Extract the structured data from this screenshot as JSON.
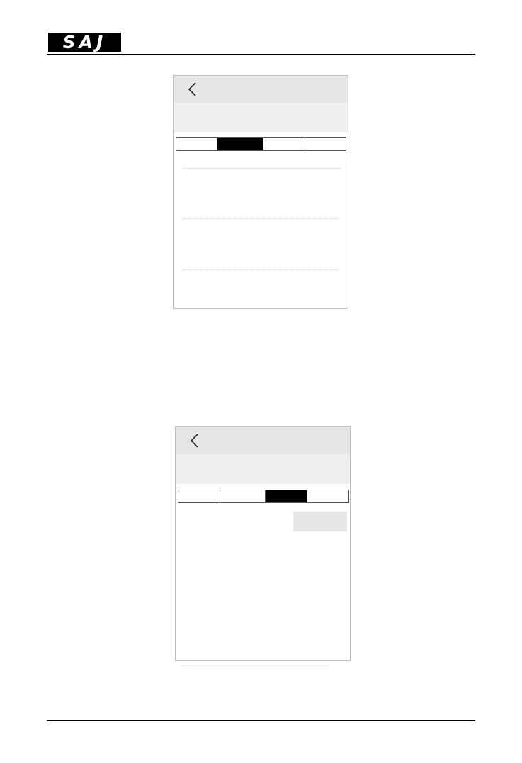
{
  "header": {
    "logo_text": "SAJ",
    "logo_color": "#000000"
  },
  "screens": [
    {
      "back_icon": "chevron-left-icon",
      "tab_count": 4,
      "active_tab_index": 1
    },
    {
      "back_icon": "chevron-left-icon",
      "tab_count": 4,
      "active_tab_index": 2
    }
  ],
  "colors": {
    "topbar": "#e6e6e6",
    "subbar": "#efefef",
    "active_tab": "#000000"
  }
}
